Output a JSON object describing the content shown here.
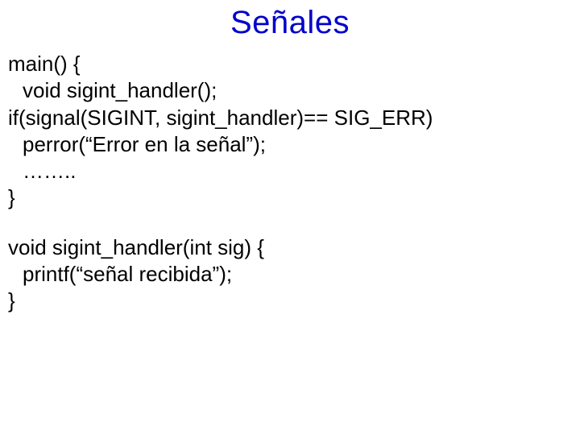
{
  "title": "Señales",
  "code": {
    "l1": "main() {",
    "l2": "void sigint_handler();",
    "l3": "if(signal(SIGINT, sigint_handler)== SIG_ERR)",
    "l4": "perror(“Error en la señal”);",
    "l5": "……..",
    "l6": "}",
    "l7": "void sigint_handler(int sig) {",
    "l8": "printf(“señal recibida”);",
    "l9": "}"
  }
}
